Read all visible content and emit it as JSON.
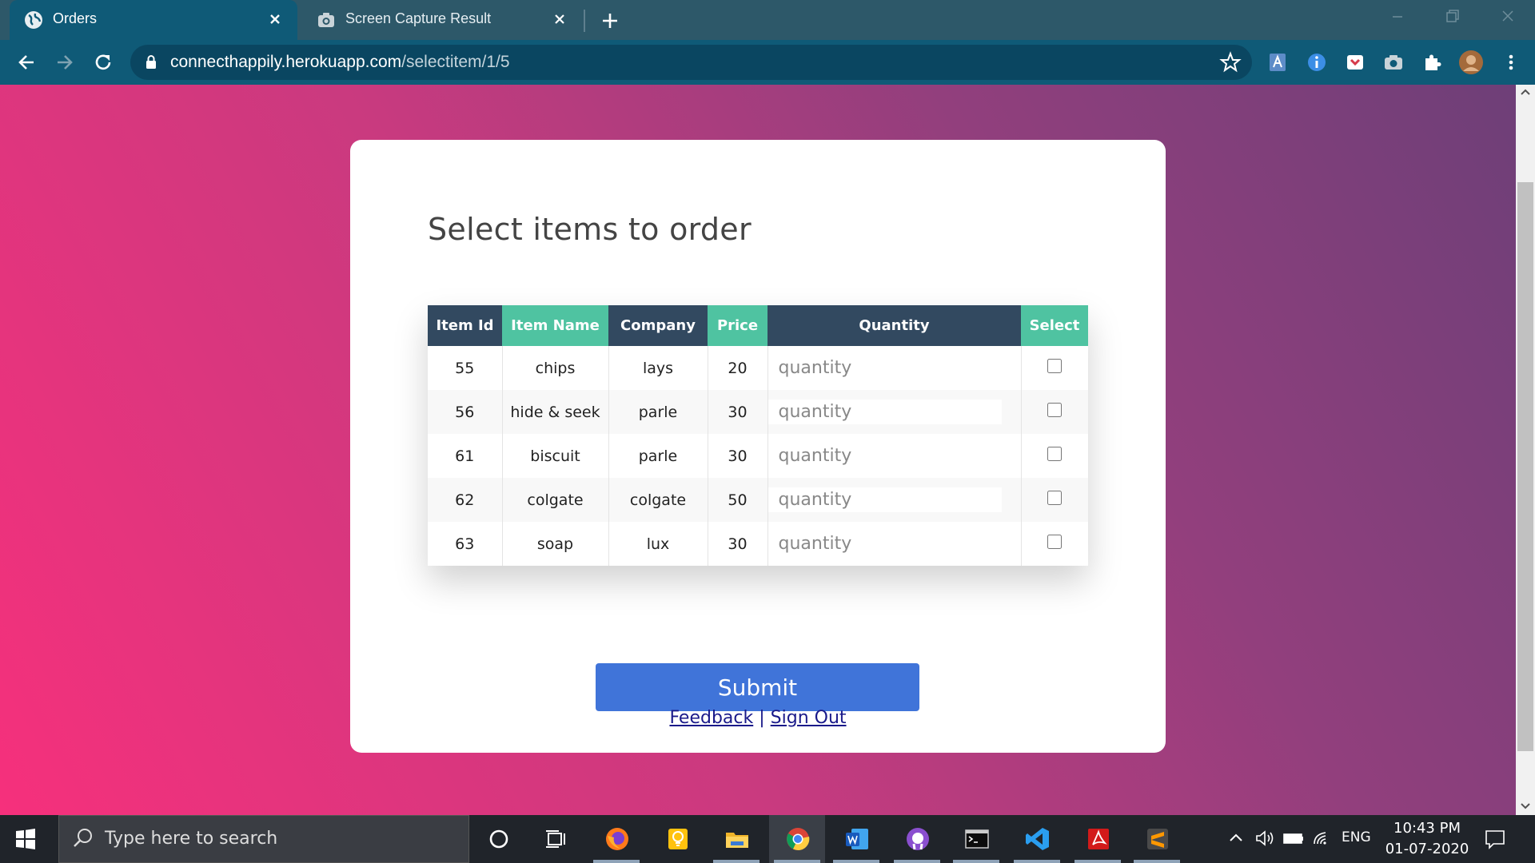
{
  "browser": {
    "tabs": [
      {
        "title": "Orders",
        "active": true
      },
      {
        "title": "Screen Capture Result",
        "active": false
      }
    ],
    "url_host": "connecthappily.herokuapp.com",
    "url_path": "/selectitem/1/5"
  },
  "page": {
    "title": "Select items to order",
    "table": {
      "headers": [
        "Item Id",
        "Item Name",
        "Company",
        "Price",
        "Quantity",
        "Select"
      ],
      "rows": [
        {
          "id": "55",
          "name": "chips",
          "company": "lays",
          "price": "20"
        },
        {
          "id": "56",
          "name": "hide & seek",
          "company": "parle",
          "price": "30"
        },
        {
          "id": "61",
          "name": "biscuit",
          "company": "parle",
          "price": "30"
        },
        {
          "id": "62",
          "name": "colgate",
          "company": "colgate",
          "price": "50"
        },
        {
          "id": "63",
          "name": "soap",
          "company": "lux",
          "price": "30"
        }
      ],
      "quantity_placeholder": "quantity"
    },
    "submit_label": "Submit",
    "feedback_label": "Feedback",
    "separator": "|",
    "signout_label": "Sign Out"
  },
  "taskbar": {
    "search_placeholder": "Type here to search",
    "language": "ENG",
    "time": "10:43 PM",
    "date": "01-07-2020"
  },
  "colors": {
    "header_dark": "#324960",
    "header_teal": "#4fc3a1",
    "submit": "#4074d9",
    "chrome": "#0f5a77"
  }
}
